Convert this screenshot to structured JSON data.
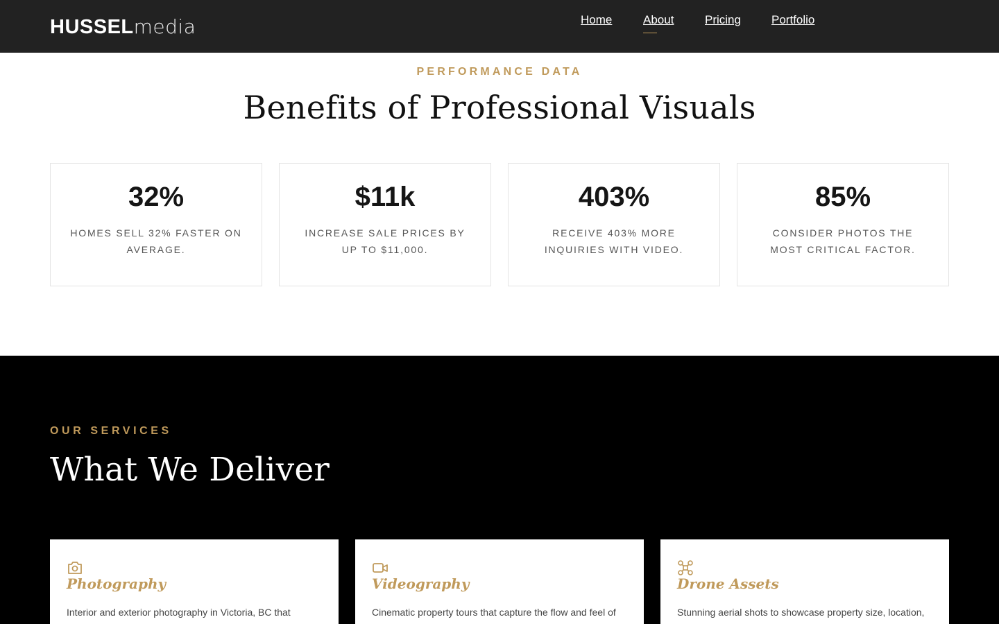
{
  "brand": {
    "bold": "HUSSEL",
    "light": "media"
  },
  "nav": {
    "items": [
      {
        "label": "Home"
      },
      {
        "label": "About"
      },
      {
        "label": "Pricing"
      },
      {
        "label": "Portfolio"
      }
    ],
    "active": "About"
  },
  "performance": {
    "kicker": "PERFORMANCE DATA",
    "title": "Benefits of Professional Visuals",
    "stats": [
      {
        "value": "32%",
        "description": "Homes sell 32% faster on average."
      },
      {
        "value": "$11k",
        "description": "Increase sale prices by up to $11,000."
      },
      {
        "value": "403%",
        "description": "Receive 403% more inquiries with video."
      },
      {
        "value": "85%",
        "description": "Consider photos the most critical factor."
      }
    ]
  },
  "services": {
    "kicker": "OUR SERVICES",
    "title": "What We Deliver",
    "cards": [
      {
        "icon": "camera-icon",
        "name": "Photography",
        "text": "Interior and exterior photography in Victoria, BC that"
      },
      {
        "icon": "video-camera-icon",
        "name": "Videography",
        "text": "Cinematic property tours that capture the flow and feel of"
      },
      {
        "icon": "drone-icon",
        "name": "Drone Assets",
        "text": "Stunning aerial shots to showcase property size, location,"
      }
    ]
  },
  "colors": {
    "accent": "#c09a5b",
    "header_bg": "#222222",
    "services_bg": "#000000"
  }
}
